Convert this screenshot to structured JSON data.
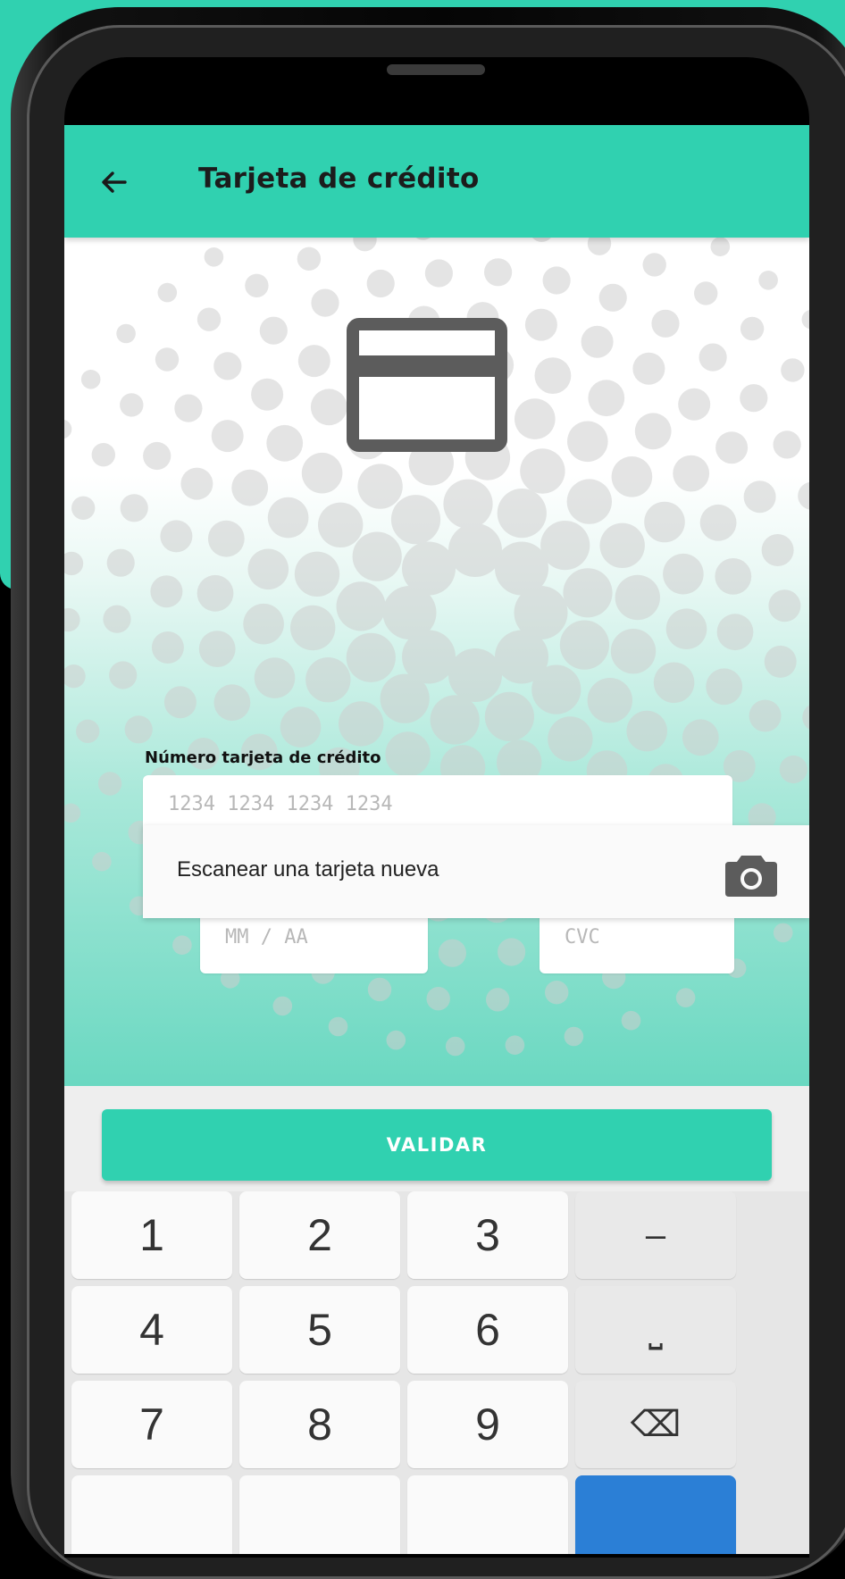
{
  "app": {
    "title": "Tarjeta de crédito",
    "back_icon": "arrow-left-icon"
  },
  "form": {
    "card_number_label": "Número tarjeta de crédito",
    "card_number_placeholder": "1234 1234 1234 1234",
    "expiry_placeholder": "MM / AA",
    "cvc_placeholder": "CVC"
  },
  "scan": {
    "label": "Escanear una tarjeta nueva",
    "icon": "camera-icon"
  },
  "actions": {
    "validate_label": "VALIDAR"
  },
  "keyboard": {
    "row1": [
      "1",
      "2",
      "3",
      "–"
    ],
    "row2": [
      "4",
      "5",
      "6",
      "⎵"
    ],
    "row3": [
      "7",
      "8",
      "9",
      "⌫"
    ]
  },
  "colors": {
    "accent": "#30d1b0",
    "icon_gray": "#5c5c5c",
    "enter_key": "#2b7fd6"
  }
}
